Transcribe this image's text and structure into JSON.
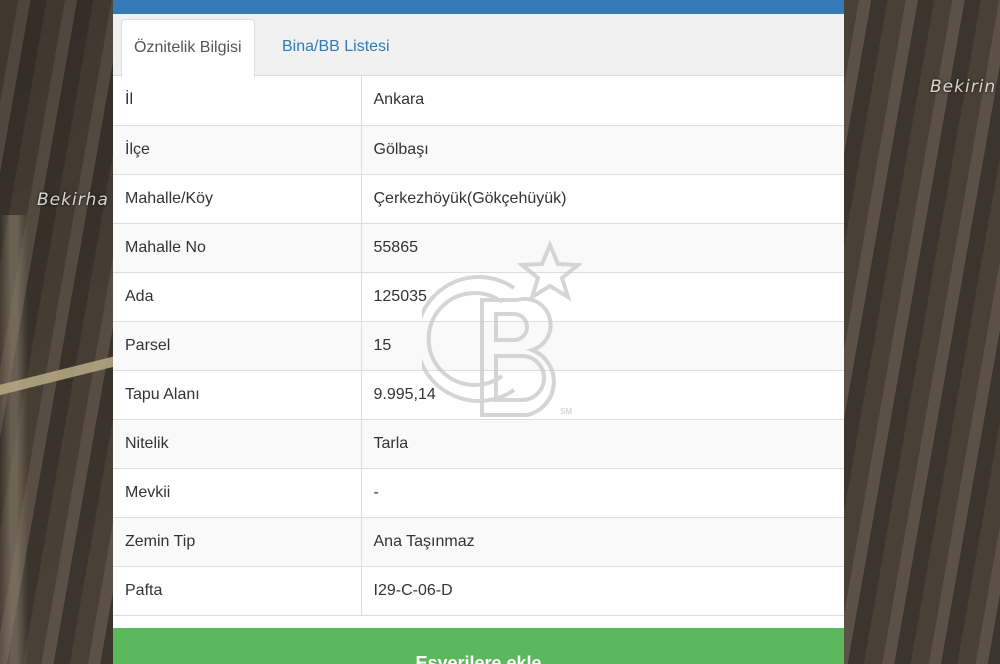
{
  "map": {
    "label_left": "Bekirha",
    "label_right": "Bekirin"
  },
  "tabs": [
    {
      "label": "Öznitelik Bilgisi",
      "active": true
    },
    {
      "label": "Bina/BB Listesi",
      "active": false
    }
  ],
  "attributes": [
    {
      "key": "İl",
      "value": "Ankara"
    },
    {
      "key": "İlçe",
      "value": "Gölbaşı"
    },
    {
      "key": "Mahalle/Köy",
      "value": "Çerkezhöyük(Gökçehüyük)"
    },
    {
      "key": "Mahalle No",
      "value": "55865"
    },
    {
      "key": "Ada",
      "value": "125035"
    },
    {
      "key": "Parsel",
      "value": "15"
    },
    {
      "key": "Tapu Alanı",
      "value": "9.995,14"
    },
    {
      "key": "Nitelik",
      "value": "Tarla"
    },
    {
      "key": "Mevkii",
      "value": "-"
    },
    {
      "key": "Zemin Tip",
      "value": "Ana Taşınmaz"
    },
    {
      "key": "Pafta",
      "value": "I29-C-06-D"
    }
  ],
  "action_button": {
    "label": "Eşyerilere ekle"
  },
  "watermark": {
    "text": "CB",
    "mark": "SM"
  },
  "colors": {
    "primary": "#337ab7",
    "success": "#5cb85c",
    "border": "#dddddd"
  }
}
